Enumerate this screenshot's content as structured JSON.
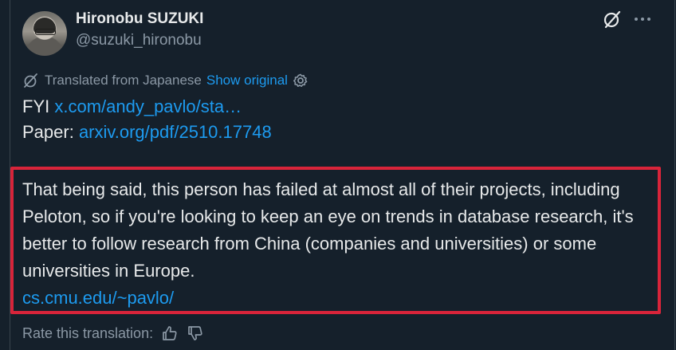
{
  "author": {
    "display_name": "Hironobu SUZUKI",
    "handle": "@suzuki_hironobu"
  },
  "icons": {
    "grok": "grok-icon",
    "more": "more-icon",
    "globe": "translate-icon",
    "settings": "gear-icon",
    "thumbs_up": "thumbs-up-icon",
    "thumbs_down": "thumbs-down-icon"
  },
  "translation": {
    "label": "Translated from Japanese",
    "show_original": "Show original"
  },
  "post": {
    "line1_prefix": "FYI ",
    "line1_link": "x.com/andy_pavlo/sta…",
    "line2_prefix": "Paper: ",
    "line2_link": "arxiv.org/pdf/2510.17748",
    "paragraph": "That being said, this person has failed at almost all of their projects, including Peloton, so if you're looking to keep an eye on trends in database research, it's better to follow research from China (companies and universities) or some universities in Europe.",
    "paragraph_link": "cs.cmu.edu/~pavlo/"
  },
  "rating": {
    "label": "Rate this translation:"
  },
  "colors": {
    "background": "#15202b",
    "text": "#e7e9ea",
    "muted": "#8b98a5",
    "link": "#1d9bf0",
    "highlight": "#d8243a"
  }
}
